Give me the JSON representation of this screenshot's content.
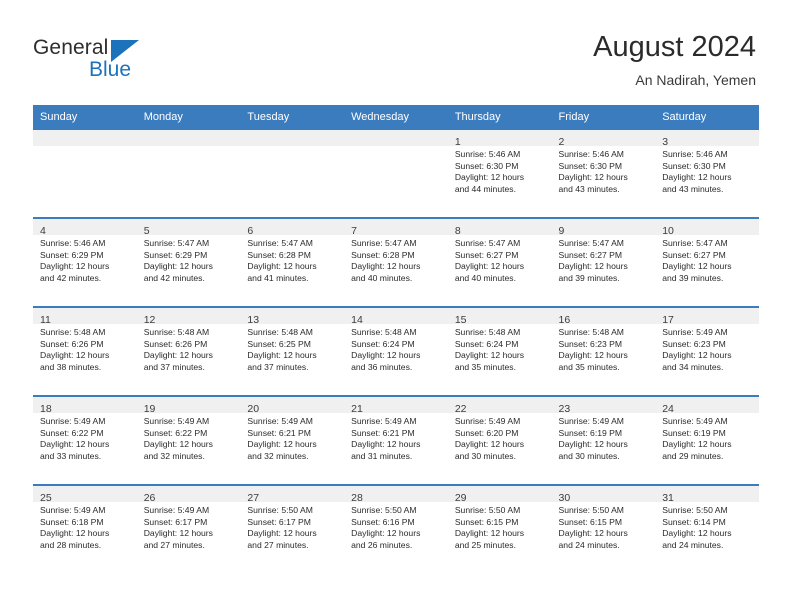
{
  "brand": {
    "name_part1": "General",
    "name_part2": "Blue",
    "accent_color": "#1c72bb"
  },
  "header": {
    "title": "August 2024",
    "location": "An Nadirah, Yemen"
  },
  "calendar": {
    "header_bg": "#3b7cbf",
    "daynum_bg": "#f0f0f0",
    "weekday_headers": [
      "Sunday",
      "Monday",
      "Tuesday",
      "Wednesday",
      "Thursday",
      "Friday",
      "Saturday"
    ],
    "weeks": [
      [
        {
          "day": "",
          "lines": []
        },
        {
          "day": "",
          "lines": []
        },
        {
          "day": "",
          "lines": []
        },
        {
          "day": "",
          "lines": []
        },
        {
          "day": "1",
          "lines": [
            "Sunrise: 5:46 AM",
            "Sunset: 6:30 PM",
            "Daylight: 12 hours",
            "and 44 minutes."
          ]
        },
        {
          "day": "2",
          "lines": [
            "Sunrise: 5:46 AM",
            "Sunset: 6:30 PM",
            "Daylight: 12 hours",
            "and 43 minutes."
          ]
        },
        {
          "day": "3",
          "lines": [
            "Sunrise: 5:46 AM",
            "Sunset: 6:30 PM",
            "Daylight: 12 hours",
            "and 43 minutes."
          ]
        }
      ],
      [
        {
          "day": "4",
          "lines": [
            "Sunrise: 5:46 AM",
            "Sunset: 6:29 PM",
            "Daylight: 12 hours",
            "and 42 minutes."
          ]
        },
        {
          "day": "5",
          "lines": [
            "Sunrise: 5:47 AM",
            "Sunset: 6:29 PM",
            "Daylight: 12 hours",
            "and 42 minutes."
          ]
        },
        {
          "day": "6",
          "lines": [
            "Sunrise: 5:47 AM",
            "Sunset: 6:28 PM",
            "Daylight: 12 hours",
            "and 41 minutes."
          ]
        },
        {
          "day": "7",
          "lines": [
            "Sunrise: 5:47 AM",
            "Sunset: 6:28 PM",
            "Daylight: 12 hours",
            "and 40 minutes."
          ]
        },
        {
          "day": "8",
          "lines": [
            "Sunrise: 5:47 AM",
            "Sunset: 6:27 PM",
            "Daylight: 12 hours",
            "and 40 minutes."
          ]
        },
        {
          "day": "9",
          "lines": [
            "Sunrise: 5:47 AM",
            "Sunset: 6:27 PM",
            "Daylight: 12 hours",
            "and 39 minutes."
          ]
        },
        {
          "day": "10",
          "lines": [
            "Sunrise: 5:47 AM",
            "Sunset: 6:27 PM",
            "Daylight: 12 hours",
            "and 39 minutes."
          ]
        }
      ],
      [
        {
          "day": "11",
          "lines": [
            "Sunrise: 5:48 AM",
            "Sunset: 6:26 PM",
            "Daylight: 12 hours",
            "and 38 minutes."
          ]
        },
        {
          "day": "12",
          "lines": [
            "Sunrise: 5:48 AM",
            "Sunset: 6:26 PM",
            "Daylight: 12 hours",
            "and 37 minutes."
          ]
        },
        {
          "day": "13",
          "lines": [
            "Sunrise: 5:48 AM",
            "Sunset: 6:25 PM",
            "Daylight: 12 hours",
            "and 37 minutes."
          ]
        },
        {
          "day": "14",
          "lines": [
            "Sunrise: 5:48 AM",
            "Sunset: 6:24 PM",
            "Daylight: 12 hours",
            "and 36 minutes."
          ]
        },
        {
          "day": "15",
          "lines": [
            "Sunrise: 5:48 AM",
            "Sunset: 6:24 PM",
            "Daylight: 12 hours",
            "and 35 minutes."
          ]
        },
        {
          "day": "16",
          "lines": [
            "Sunrise: 5:48 AM",
            "Sunset: 6:23 PM",
            "Daylight: 12 hours",
            "and 35 minutes."
          ]
        },
        {
          "day": "17",
          "lines": [
            "Sunrise: 5:49 AM",
            "Sunset: 6:23 PM",
            "Daylight: 12 hours",
            "and 34 minutes."
          ]
        }
      ],
      [
        {
          "day": "18",
          "lines": [
            "Sunrise: 5:49 AM",
            "Sunset: 6:22 PM",
            "Daylight: 12 hours",
            "and 33 minutes."
          ]
        },
        {
          "day": "19",
          "lines": [
            "Sunrise: 5:49 AM",
            "Sunset: 6:22 PM",
            "Daylight: 12 hours",
            "and 32 minutes."
          ]
        },
        {
          "day": "20",
          "lines": [
            "Sunrise: 5:49 AM",
            "Sunset: 6:21 PM",
            "Daylight: 12 hours",
            "and 32 minutes."
          ]
        },
        {
          "day": "21",
          "lines": [
            "Sunrise: 5:49 AM",
            "Sunset: 6:21 PM",
            "Daylight: 12 hours",
            "and 31 minutes."
          ]
        },
        {
          "day": "22",
          "lines": [
            "Sunrise: 5:49 AM",
            "Sunset: 6:20 PM",
            "Daylight: 12 hours",
            "and 30 minutes."
          ]
        },
        {
          "day": "23",
          "lines": [
            "Sunrise: 5:49 AM",
            "Sunset: 6:19 PM",
            "Daylight: 12 hours",
            "and 30 minutes."
          ]
        },
        {
          "day": "24",
          "lines": [
            "Sunrise: 5:49 AM",
            "Sunset: 6:19 PM",
            "Daylight: 12 hours",
            "and 29 minutes."
          ]
        }
      ],
      [
        {
          "day": "25",
          "lines": [
            "Sunrise: 5:49 AM",
            "Sunset: 6:18 PM",
            "Daylight: 12 hours",
            "and 28 minutes."
          ]
        },
        {
          "day": "26",
          "lines": [
            "Sunrise: 5:49 AM",
            "Sunset: 6:17 PM",
            "Daylight: 12 hours",
            "and 27 minutes."
          ]
        },
        {
          "day": "27",
          "lines": [
            "Sunrise: 5:50 AM",
            "Sunset: 6:17 PM",
            "Daylight: 12 hours",
            "and 27 minutes."
          ]
        },
        {
          "day": "28",
          "lines": [
            "Sunrise: 5:50 AM",
            "Sunset: 6:16 PM",
            "Daylight: 12 hours",
            "and 26 minutes."
          ]
        },
        {
          "day": "29",
          "lines": [
            "Sunrise: 5:50 AM",
            "Sunset: 6:15 PM",
            "Daylight: 12 hours",
            "and 25 minutes."
          ]
        },
        {
          "day": "30",
          "lines": [
            "Sunrise: 5:50 AM",
            "Sunset: 6:15 PM",
            "Daylight: 12 hours",
            "and 24 minutes."
          ]
        },
        {
          "day": "31",
          "lines": [
            "Sunrise: 5:50 AM",
            "Sunset: 6:14 PM",
            "Daylight: 12 hours",
            "and 24 minutes."
          ]
        }
      ]
    ]
  }
}
